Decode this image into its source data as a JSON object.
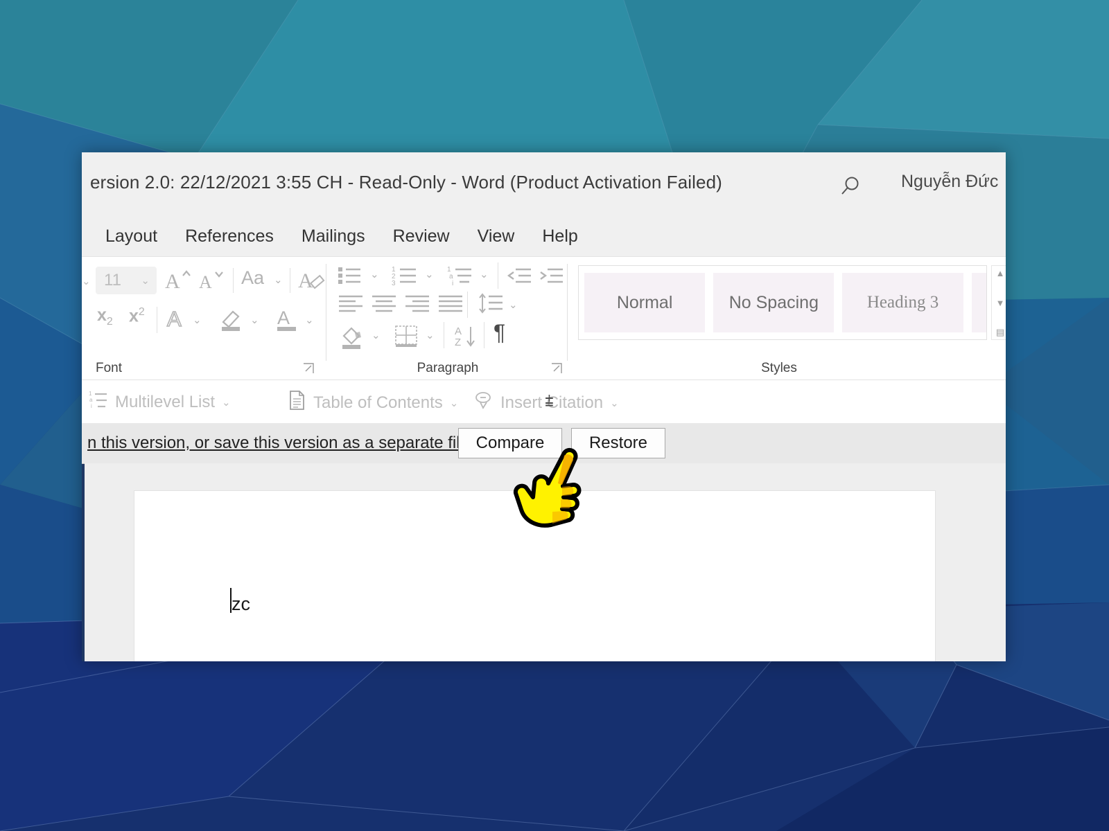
{
  "desktop": {
    "wallpaper_name": "low-poly-blue-wallpaper",
    "colors": {
      "teal_light": "#2f8ca0",
      "teal": "#2a7f96",
      "blue_mid": "#1f6190",
      "blue": "#1c4f87",
      "navy": "#1b3a7a",
      "navy_dark": "#14306b",
      "navy_deep": "#122a63"
    }
  },
  "window": {
    "title": "ersion 2.0: 22/12/2021 3:55 CH  -  Read-Only  -  Word (Product Activation Failed)",
    "account_name": "Nguyễn Đức",
    "search_icon": "search-icon"
  },
  "ribbon": {
    "tabs": [
      {
        "label": "Layout"
      },
      {
        "label": "References"
      },
      {
        "label": "Mailings"
      },
      {
        "label": "Review"
      },
      {
        "label": "View"
      },
      {
        "label": "Help"
      }
    ],
    "groups": {
      "font": {
        "label": "Font",
        "font_size_value": "11",
        "dialog_launcher": "⌐",
        "icons": [
          "grow-font-icon",
          "shrink-font-icon",
          "change-case-icon",
          "clear-formatting-icon",
          "subscript-icon",
          "superscript-icon",
          "text-effects-icon",
          "text-highlight-color-icon",
          "font-color-icon"
        ]
      },
      "paragraph": {
        "label": "Paragraph",
        "dialog_launcher": "⌐",
        "icons": [
          "bullets-icon",
          "numbering-icon",
          "multilevel-list-icon",
          "decrease-indent-icon",
          "increase-indent-icon",
          "align-left-icon",
          "center-icon",
          "align-right-icon",
          "justify-icon",
          "line-spacing-icon",
          "shading-icon",
          "borders-icon",
          "sort-icon",
          "show-formatting-marks-icon"
        ]
      },
      "styles": {
        "label": "Styles",
        "cards": [
          {
            "name": "Normal"
          },
          {
            "name": "No Spacing"
          },
          {
            "name": "Heading 3"
          }
        ],
        "scroll_up": "▲",
        "scroll_down": "▼",
        "more": "▤"
      }
    }
  },
  "toolbar": {
    "items": [
      {
        "label": "Multilevel List",
        "icon": "multilevel-list-icon",
        "chevron": "⌄"
      },
      {
        "label": "Table of Contents",
        "icon": "table-of-contents-icon",
        "chevron": "⌄"
      },
      {
        "label": "Insert Citation",
        "icon": "insert-citation-icon",
        "chevron": "⌄"
      }
    ],
    "overflow": "⩲"
  },
  "message_bar": {
    "text": "n this version, or save this version as a separate file.",
    "compare_label": "Compare",
    "restore_label": "Restore"
  },
  "document": {
    "body_text": "zc"
  },
  "cursor": {
    "type": "hand-pointer-cursor",
    "fill": "#fff200",
    "shade": "#f0a000",
    "outline": "#000000"
  }
}
